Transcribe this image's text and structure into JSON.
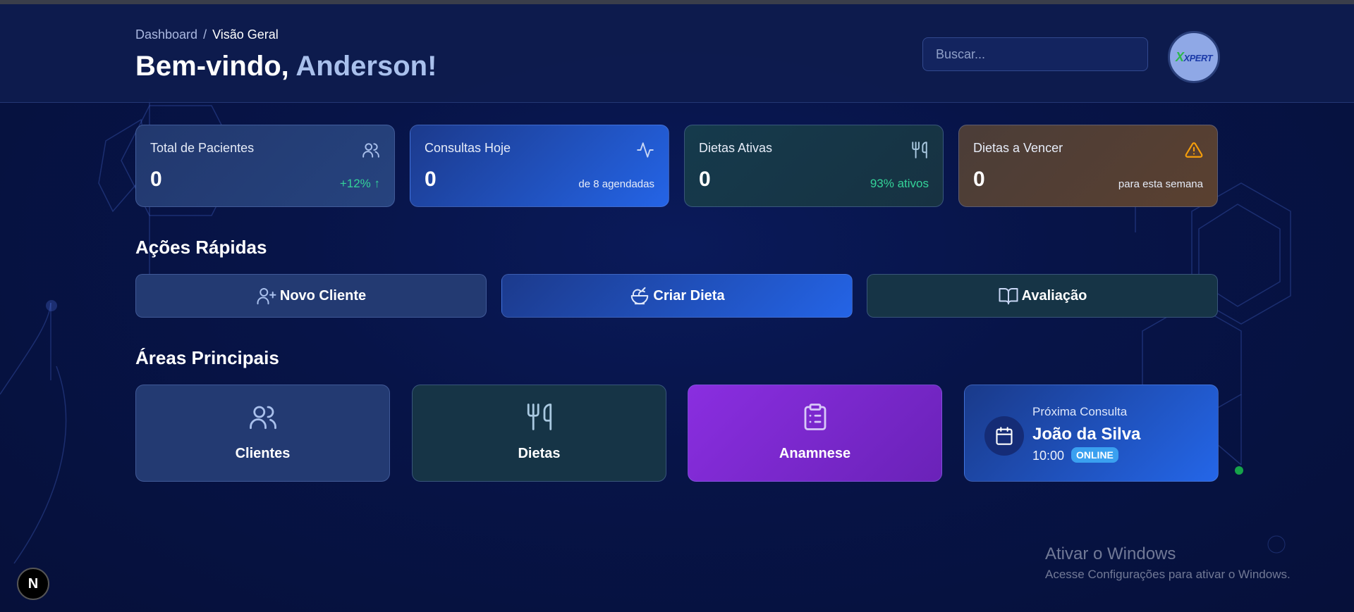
{
  "header": {
    "breadcrumb_root": "Dashboard",
    "breadcrumb_sep": "/",
    "breadcrumb_current": "Visão Geral",
    "welcome_prefix": "Bem-vindo, ",
    "welcome_name": "Anderson!",
    "search_placeholder": "Buscar...",
    "avatar_logo": "XPERT"
  },
  "stats": [
    {
      "label": "Total de Pacientes",
      "value": "0",
      "note": "+12% ↑",
      "icon": "users-icon"
    },
    {
      "label": "Consultas Hoje",
      "value": "0",
      "note": "de 8 agendadas",
      "icon": "activity-icon"
    },
    {
      "label": "Dietas Ativas",
      "value": "0",
      "note": "93% ativos",
      "icon": "utensils-icon"
    },
    {
      "label": "Dietas a Vencer",
      "value": "0",
      "note": "para esta semana",
      "icon": "warning-icon"
    }
  ],
  "quick_actions": {
    "title": "Ações Rápidas",
    "items": [
      {
        "label": "Novo Cliente",
        "icon": "user-plus-icon"
      },
      {
        "label": "Criar Dieta",
        "icon": "salad-icon"
      },
      {
        "label": "Avaliação",
        "icon": "book-open-icon"
      }
    ]
  },
  "main_areas": {
    "title": "Áreas Principais",
    "items": [
      {
        "label": "Clientes",
        "icon": "users-icon"
      },
      {
        "label": "Dietas",
        "icon": "utensils-icon"
      },
      {
        "label": "Anamnese",
        "icon": "clipboard-icon"
      }
    ],
    "next_consult": {
      "label": "Próxima Consulta",
      "name": "João da Silva",
      "time": "10:00",
      "badge": "ONLINE",
      "icon": "calendar-icon"
    }
  },
  "windows_watermark": {
    "title": "Ativar o Windows",
    "subtitle": "Acesse Configurações para ativar o Windows."
  },
  "dev_badge": "N",
  "colors": {
    "accent_blue": "#2464e6",
    "positive_green": "#34d399",
    "warning_orange": "#f59e0b",
    "purple": "#8a2ee0",
    "badge_blue": "#3aa0f0"
  }
}
